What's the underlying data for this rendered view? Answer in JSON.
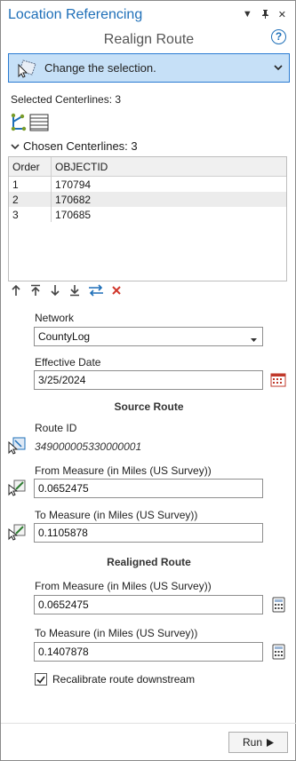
{
  "header": {
    "title": "Location Referencing",
    "subtitle": "Realign Route",
    "help_glyph": "?"
  },
  "step": {
    "label": "Change the selection."
  },
  "selected_centerlines": "Selected Centerlines: 3",
  "chosen": {
    "label": "Chosen Centerlines: 3",
    "columns": [
      "Order",
      "OBJECTID"
    ],
    "rows": [
      {
        "order": "1",
        "objectid": "170794"
      },
      {
        "order": "2",
        "objectid": "170682"
      },
      {
        "order": "3",
        "objectid": "170685"
      }
    ]
  },
  "network": {
    "label": "Network",
    "value": "CountyLog"
  },
  "effective_date": {
    "label": "Effective Date",
    "value": "3/25/2024"
  },
  "source_route": {
    "heading": "Source Route",
    "route_id_label": "Route ID",
    "route_id_value": "349000005330000001",
    "from_label": "From Measure (in Miles (US Survey))",
    "from_value": "0.0652475",
    "to_label": "To Measure (in Miles (US Survey))",
    "to_value": "0.1105878"
  },
  "realigned_route": {
    "heading": "Realigned Route",
    "from_label": "From Measure (in Miles (US Survey))",
    "from_value": "0.0652475",
    "to_label": "To Measure (in Miles (US Survey))",
    "to_value": "0.1407878",
    "recalibrate_label": "Recalibrate route downstream",
    "recalibrate_checked": true
  },
  "run_label": "Run",
  "colors": {
    "accent": "#1e6fb8",
    "step_bg": "#c6e0f7",
    "delete": "#d0362b"
  }
}
